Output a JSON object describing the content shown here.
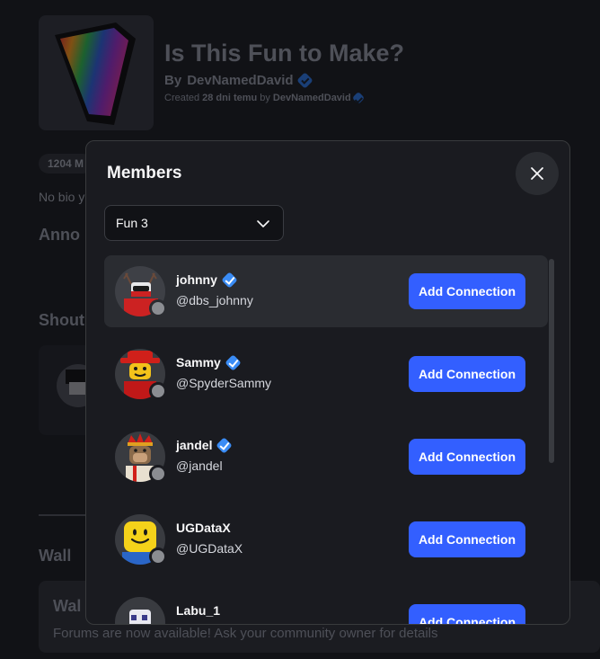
{
  "group": {
    "title": "Is This Fun to Make?",
    "by_prefix": "By",
    "owner": "DevNamedDavid",
    "created_prefix": "Created",
    "created_age": "28 dni temu",
    "created_by": "by",
    "created_owner": "DevNamedDavid",
    "member_count": "1204 M",
    "bio": "No bio y",
    "announcements_heading": "Anno",
    "shout_heading": "Shout",
    "wall_heading": "Wall",
    "wall_card_title": "Wal",
    "wall_card_text": "Forums are now available! Ask your community owner for details"
  },
  "modal": {
    "title": "Members",
    "role_select": {
      "value": "Fun 3"
    },
    "add_label": "Add Connection",
    "members": [
      {
        "display_name": "johnny",
        "username": "@dbs_johnny",
        "verified": true,
        "avatar": "johnny"
      },
      {
        "display_name": "Sammy",
        "username": "@SpyderSammy",
        "verified": true,
        "avatar": "sammy"
      },
      {
        "display_name": "jandel",
        "username": "@jandel",
        "verified": true,
        "avatar": "jandel"
      },
      {
        "display_name": "UGDataX",
        "username": "@UGDataX",
        "verified": false,
        "avatar": "ugdatax"
      },
      {
        "display_name": "Labu_1",
        "username": "",
        "verified": false,
        "avatar": "labu"
      }
    ]
  },
  "colors": {
    "accent": "#335fff",
    "verified": "#3a8cf5",
    "presence_offline": "#8b8d92"
  }
}
